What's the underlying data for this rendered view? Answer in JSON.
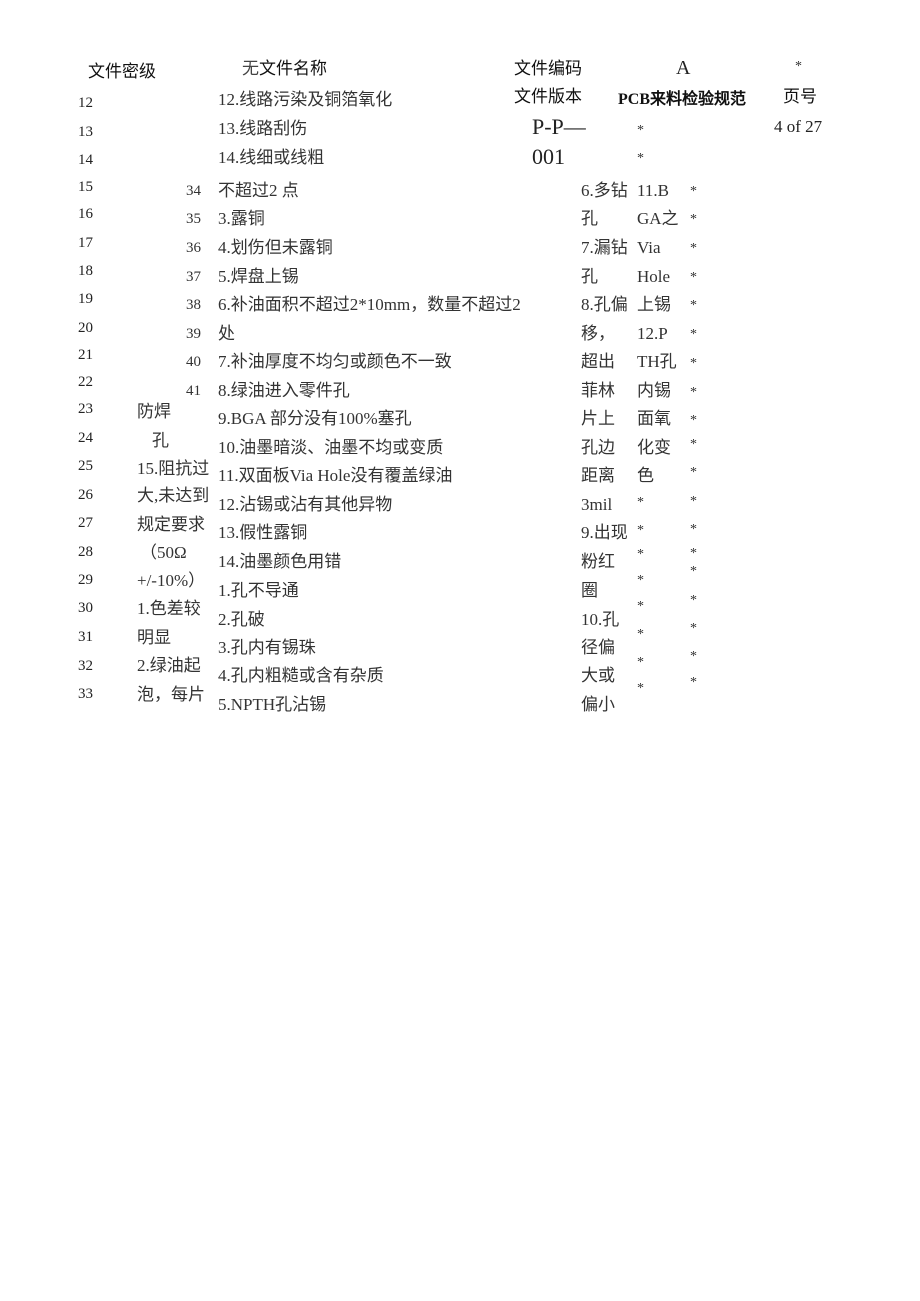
{
  "header": {
    "secrecy_label": "文件密级",
    "secrecy_value": "无",
    "name_label": "文件名称",
    "code_label": "文件编码",
    "code_value": "A",
    "version_label": "文件版本",
    "version_value_line1": "P-P—",
    "version_value_line2": "001",
    "doc_title": "PCB来料检验规范",
    "page_label": "页号",
    "page_value": "4 of 27",
    "star_top": "*",
    "star_a": "*",
    "star_b": "*"
  },
  "line_numbers": [
    "12",
    "13",
    "14",
    "15",
    "16",
    "17",
    "18",
    "19",
    "20",
    "21",
    "22",
    "23",
    "24",
    "25",
    "26",
    "27",
    "28",
    "29",
    "30",
    "31",
    "32",
    "33"
  ],
  "sub_numbers": [
    "34",
    "35",
    "36",
    "37",
    "38",
    "39",
    "40",
    "41"
  ],
  "category_column": [
    "防焊",
    "孔",
    "15.阻抗过",
    "大,未达到",
    "规定要求",
    "（50Ω",
    "+/-10%）",
    "1.色差较",
    "明显",
    "2.绿油起",
    "泡，每片"
  ],
  "defect_items": [
    "12.线路污染及铜箔氧化",
    "13.线路刮伤",
    "14.线细或线粗",
    "不超过2  点",
    "3.露铜",
    "4.划伤但未露铜",
    "5.焊盘上锡",
    "6.补油面积不超过2*10mm，数量不超过2",
    "处",
    "7.补油厚度不均匀或颜色不一致",
    "8.绿油进入零件孔",
    "9.BGA  部分没有100%塞孔",
    "10.油墨暗淡、油墨不均或变质",
    "11.双面板Via  Hole没有覆盖绿油",
    "12.沾锡或沾有其他异物",
    "13.假性露铜",
    "14.油墨颜色用错",
    "1.孔不导通",
    "2.孔破",
    "3.孔内有锡珠",
    "4.孔内粗糙或含有杂质",
    "5.NPTH孔沾锡"
  ],
  "drill_column": [
    "6.多钻",
    "孔",
    "7.漏钻",
    "孔",
    "8.孔偏",
    "移，",
    "超出",
    "菲林",
    "片上",
    "孔边",
    "距离",
    "3mil",
    "9.出现",
    "粉红",
    "圈",
    "10.孔",
    "径偏",
    "大或",
    "偏小"
  ],
  "pth_column": [
    "11.B",
    "GA之",
    "Via",
    "Hole",
    "上锡",
    "12.P",
    "TH孔",
    "内锡",
    "面氧",
    "化变",
    "色"
  ],
  "star_symbol": "*"
}
